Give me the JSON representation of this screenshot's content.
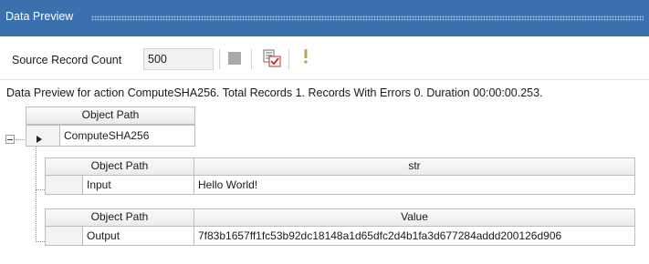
{
  "panel": {
    "title": "Data Preview"
  },
  "toolbar": {
    "source_record_count_label": "Source Record Count",
    "source_record_count_value": "500",
    "stop_icon": "stop-icon",
    "preview_icon": "preview-check-icon",
    "warning_icon": "exclamation-icon"
  },
  "status_text": "Data Preview for action ComputeSHA256. Total Records 1. Records With Errors 0. Duration 00:00:00.253.",
  "root_table": {
    "header": "Object Path",
    "row_value": "ComputeSHA256"
  },
  "input_table": {
    "headers": [
      "Object Path",
      "str"
    ],
    "rows": [
      [
        "Input",
        "Hello World!"
      ]
    ]
  },
  "output_table": {
    "headers": [
      "Object Path",
      "Value"
    ],
    "rows": [
      [
        "Output",
        "7f83b1657ff1fc53b92dc18148a1d65dfc2d4b1fa3d677284addd200126d906"
      ]
    ]
  }
}
